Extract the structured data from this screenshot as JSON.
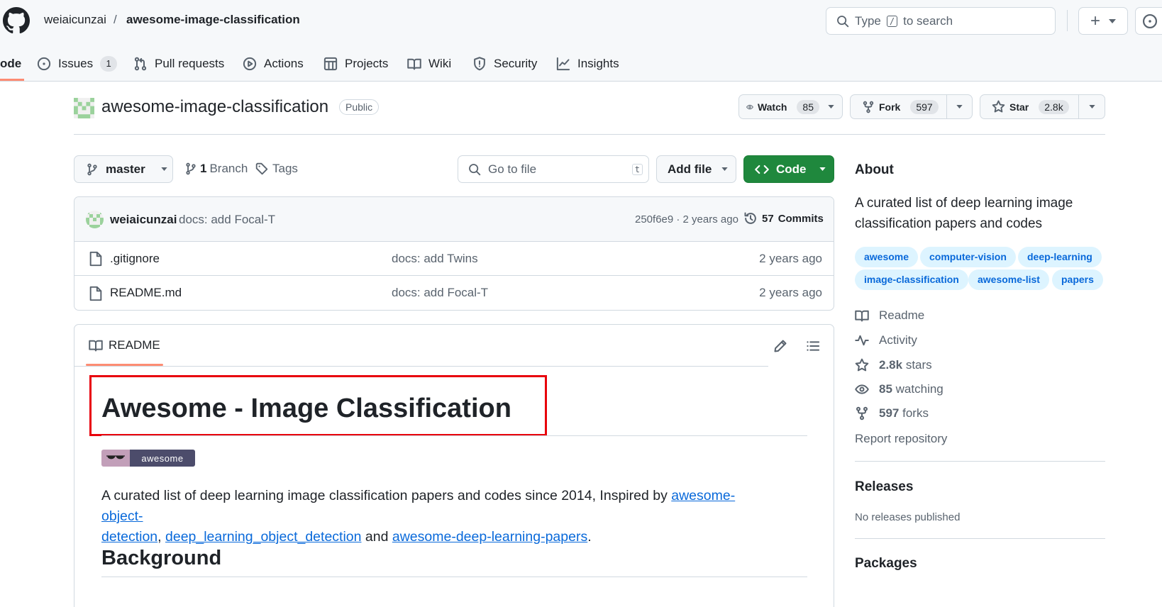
{
  "header": {
    "owner": "weiaicunzai",
    "separator": "/",
    "repo": "awesome-image-classification",
    "search": {
      "prefix": "Type",
      "key": "/",
      "suffix": "to search"
    },
    "plus_label": "+"
  },
  "nav": {
    "tabs": [
      {
        "label": "ode",
        "icon": "code-icon"
      },
      {
        "label": "Issues",
        "count": "1",
        "icon": "issue-icon"
      },
      {
        "label": "Pull requests",
        "icon": "pull-request-icon"
      },
      {
        "label": "Actions",
        "icon": "play-icon"
      },
      {
        "label": "Projects",
        "icon": "table-icon"
      },
      {
        "label": "Wiki",
        "icon": "book-icon"
      },
      {
        "label": "Security",
        "icon": "shield-icon"
      },
      {
        "label": "Insights",
        "icon": "graph-icon"
      }
    ]
  },
  "repo": {
    "name": "awesome-image-classification",
    "visibility": "Public",
    "watch": {
      "label": "Watch",
      "count": "85"
    },
    "fork": {
      "label": "Fork",
      "count": "597"
    },
    "star": {
      "label": "Star",
      "count": "2.8k"
    }
  },
  "toolbar": {
    "branch": "master",
    "branch_count": "1",
    "branch_label": "Branch",
    "tags_label": "Tags",
    "goto_placeholder": "Go to file",
    "goto_key": "t",
    "add_file": "Add file",
    "code": "Code"
  },
  "commit": {
    "author": "weiaicunzai",
    "message": "docs: add Focal-T",
    "meta": "250f6e9 · 2 years ago",
    "commits_count": "57",
    "commits_label": "Commits"
  },
  "files": [
    {
      "name": ".gitignore",
      "message": "docs: add Twins",
      "age": "2 years ago"
    },
    {
      "name": "README.md",
      "message": "docs: add Focal-T",
      "age": "2 years ago"
    }
  ],
  "readme": {
    "tab_label": "README",
    "title": "Awesome - Image Classification",
    "badge_text": "awesome",
    "intro_text": "A curated list of deep learning image classification papers and codes since 2014, Inspired by",
    "link1_line1": "awesome-object-",
    "link1_line2": "detection",
    "comma": ",",
    "link2": "deep_learning_object_detection",
    "and_text": "and",
    "link3": "awesome-deep-learning-papers",
    "period": ".",
    "background_heading": "Background"
  },
  "about": {
    "heading": "About",
    "description": "A curated list of deep learning image classification papers and codes",
    "topics": [
      "awesome",
      "computer-vision",
      "deep-learning",
      "image-classification",
      "awesome-list",
      "papers"
    ],
    "readme": "Readme",
    "activity": "Activity",
    "stars_count": "2.8k",
    "stars_label": "stars",
    "watching_count": "85",
    "watching_label": "watching",
    "forks_count": "597",
    "forks_label": "forks",
    "report": "Report repository",
    "releases_heading": "Releases",
    "releases_text": "No releases published",
    "packages_heading": "Packages"
  },
  "colors": {
    "accent_green": "#1f883d",
    "link_blue": "#0969da",
    "highlight_red": "#e8000b",
    "tab_underline": "#fd8c73"
  }
}
